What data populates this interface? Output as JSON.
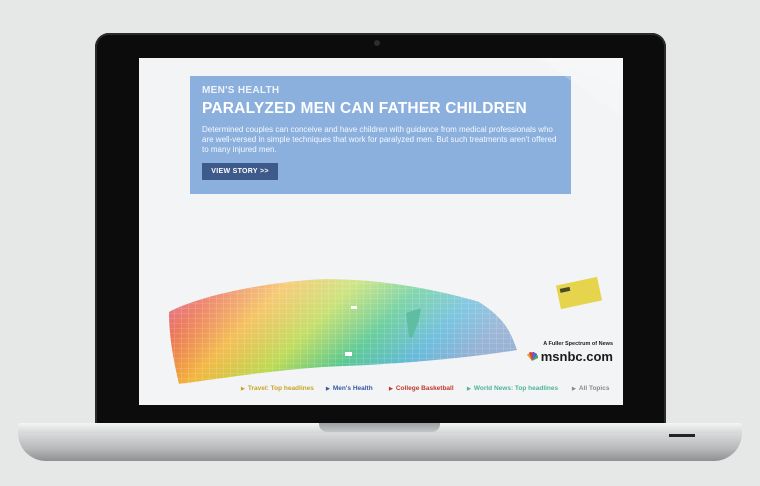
{
  "story": {
    "section": "MEN'S HEALTH",
    "headline": "PARALYZED MEN CAN FATHER CHILDREN",
    "body": "Determined couples can conceive and have children with guidance from medical professionals who are well-versed in simple techniques that work for paralyzed men. But such treatments aren't offered to many injured men.",
    "button_label": "VIEW STORY  >>"
  },
  "brand": {
    "tagline": "A Fuller Spectrum of News",
    "logo_text": "msnbc.com"
  },
  "nav": [
    {
      "label": "Travel: Top headlines",
      "color": "#c9a42a"
    },
    {
      "label": "Men's Health",
      "color": "#3a57a8"
    },
    {
      "label": "College Basketball",
      "color": "#c23a2b"
    },
    {
      "label": "World News: Top headlines",
      "color": "#4fb39a"
    },
    {
      "label": "All Topics",
      "color": "#8a8a8a"
    }
  ],
  "colors": {
    "card": "#8bb0de",
    "button": "#3d5a8a",
    "spike": "#5fbea2",
    "yellow_card": "#e6d44c"
  }
}
